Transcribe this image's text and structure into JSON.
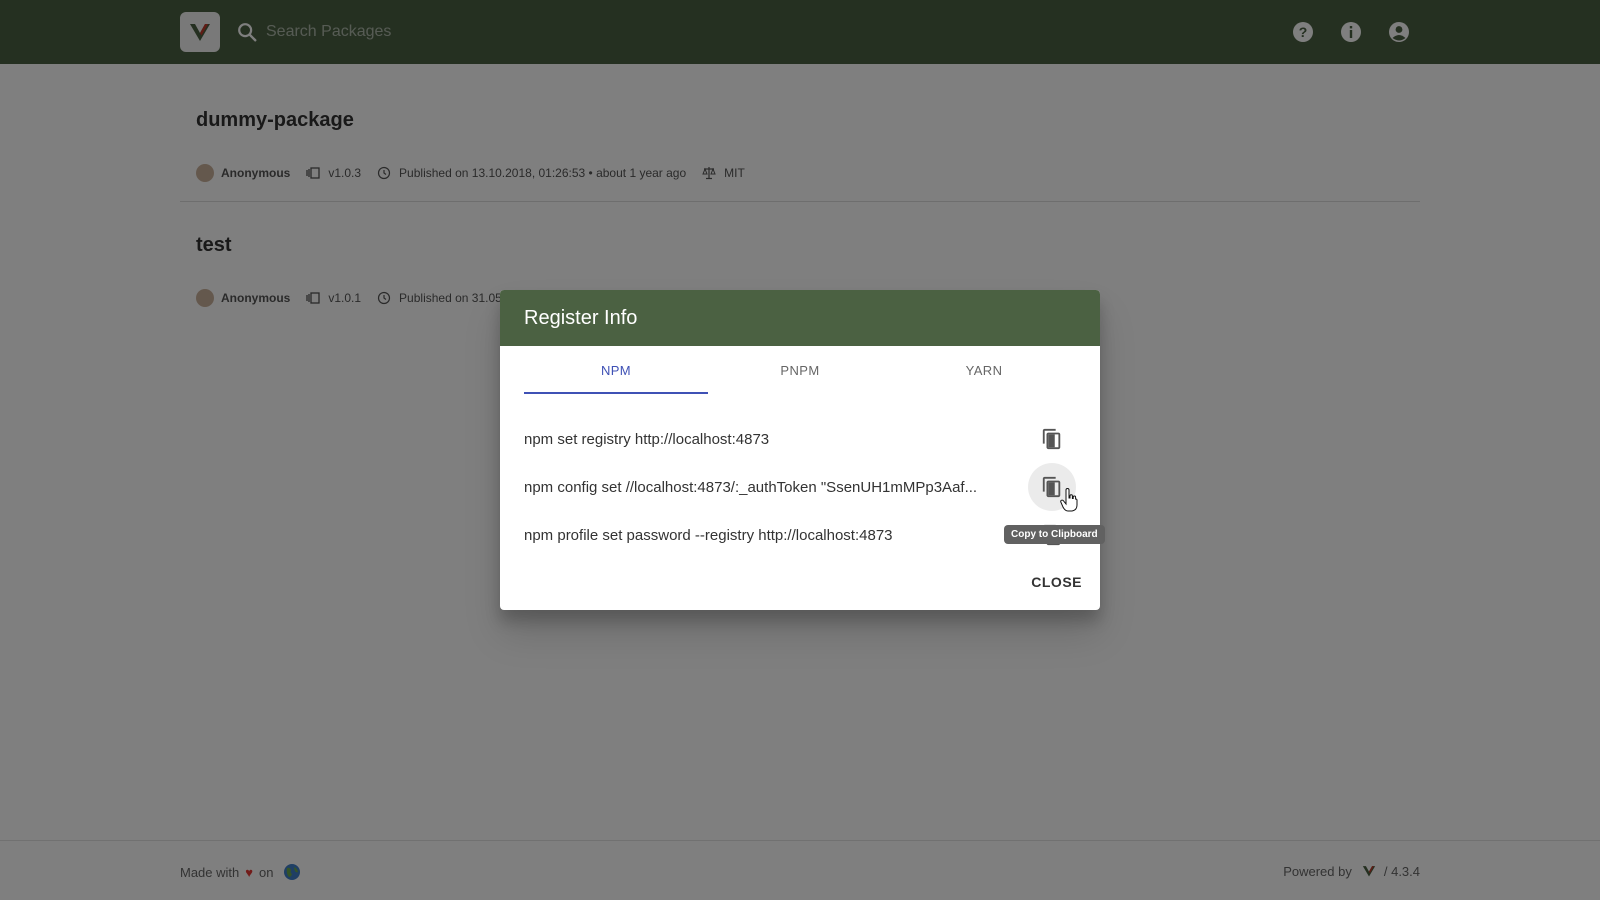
{
  "header": {
    "search_placeholder": "Search Packages",
    "logo_icon": "verdaccio-logo-icon",
    "help_icon": "help-circle-icon",
    "info_icon": "info-icon",
    "account_icon": "account-circle-icon",
    "bg_color": "#4b6142"
  },
  "packages": [
    {
      "name": "dummy-package",
      "author": "Anonymous",
      "version": "v1.0.3",
      "published": "Published on 13.10.2018, 01:26:53 • about 1 year ago",
      "license": "MIT"
    },
    {
      "name": "test",
      "author": "Anonymous",
      "version": "v1.0.1",
      "published": "Published on 31.05.",
      "license": ""
    }
  ],
  "dialog": {
    "title": "Register Info",
    "tabs": [
      "NPM",
      "PNPM",
      "YARN"
    ],
    "active_tab": "NPM",
    "commands": [
      "npm set registry http://localhost:4873",
      "npm config set //localhost:4873/:_authToken \"SsenUH1mMPp3Aaf...",
      "npm profile set password --registry http://localhost:4873"
    ],
    "tooltip": "Copy to Clipboard",
    "close_label": "CLOSE",
    "accent_color": "#3f51b5"
  },
  "footer": {
    "made_with": "Made with",
    "heart": "♥",
    "on": "on",
    "powered_by": "Powered by",
    "version": "/ 4.3.4"
  }
}
